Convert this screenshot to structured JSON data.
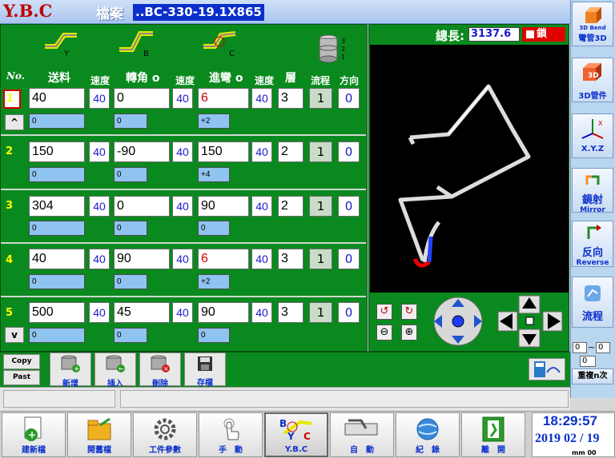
{
  "title": {
    "app": "Y.B.C",
    "file_label": "檔案",
    "file_name": "..BC-330-19.1X865"
  },
  "axis_labels": {
    "y": "Y",
    "b": "B",
    "c": "C",
    "stack": "3\n2\n1"
  },
  "headers": {
    "no": "No.",
    "feed": "送料",
    "speed1": "速度",
    "rotate": "轉角 o",
    "speed2": "速度",
    "bend": "進彎 o",
    "speed3": "速度",
    "layer": "層",
    "flow": "流程",
    "direction": "方向"
  },
  "rows": [
    {
      "no": "1",
      "feed": "40",
      "s1": "40",
      "rotate": "0",
      "s2": "40",
      "bend": "6",
      "bend_red": true,
      "s3": "40",
      "layer": "3",
      "flow": "1",
      "dir": "0",
      "sub1": "0",
      "sub2": "0",
      "sub3": "+2",
      "nav": "^"
    },
    {
      "no": "2",
      "feed": "150",
      "s1": "40",
      "rotate": "-90",
      "s2": "40",
      "bend": "150",
      "bend_red": false,
      "s3": "40",
      "layer": "2",
      "flow": "1",
      "dir": "0",
      "sub1": "0",
      "sub2": "0",
      "sub3": "+4",
      "nav": ""
    },
    {
      "no": "3",
      "feed": "304",
      "s1": "40",
      "rotate": "0",
      "s2": "40",
      "bend": "90",
      "bend_red": false,
      "s3": "40",
      "layer": "2",
      "flow": "1",
      "dir": "0",
      "sub1": "0",
      "sub2": "0",
      "sub3": "0",
      "nav": ""
    },
    {
      "no": "4",
      "feed": "40",
      "s1": "40",
      "rotate": "90",
      "s2": "40",
      "bend": "6",
      "bend_red": true,
      "s3": "40",
      "layer": "3",
      "flow": "1",
      "dir": "0",
      "sub1": "0",
      "sub2": "0",
      "sub3": "+2",
      "nav": ""
    },
    {
      "no": "5",
      "feed": "500",
      "s1": "40",
      "rotate": "45",
      "s2": "40",
      "bend": "90",
      "bend_red": false,
      "s3": "40",
      "layer": "3",
      "flow": "1",
      "dir": "0",
      "sub1": "0",
      "sub2": "0",
      "sub3": "0",
      "nav": "v"
    }
  ],
  "total": {
    "label": "總長:",
    "value": "3137.6",
    "lock": "鎖"
  },
  "sidebar": [
    {
      "label": "3D Bend",
      "sub": "彎管3D"
    },
    {
      "label": "3D",
      "sub": "3D管件"
    },
    {
      "label": "X.Y.Z",
      "sub": ""
    },
    {
      "label": "鏡射",
      "sub": "Mirror"
    },
    {
      "label": "反向",
      "sub": "Reverse"
    },
    {
      "label": "流程",
      "sub": ""
    },
    {
      "label": "重複n次",
      "sub": ""
    }
  ],
  "repeat_range": {
    "from": "0",
    "sep": "~",
    "to": "0",
    "count": "0"
  },
  "toolbar": {
    "copy": "Copy",
    "paste": "Past",
    "add": "新增",
    "insert": "插入",
    "delete": "刪除",
    "save": "存檔"
  },
  "bottom": {
    "new_file": "建新檔",
    "open_file": "開舊檔",
    "params": "工件參數",
    "manual": "手　動",
    "ybc": "Y.B.C",
    "auto": "自　動",
    "record": "紀　錄",
    "exit": "離　開"
  },
  "clock": {
    "time": "18:29:57",
    "date": "2019 02 / 19",
    "units": "mm  00"
  },
  "colors": {
    "panel": "#0a8a1e",
    "accent": "#0a2fcc",
    "red": "#d00000"
  }
}
